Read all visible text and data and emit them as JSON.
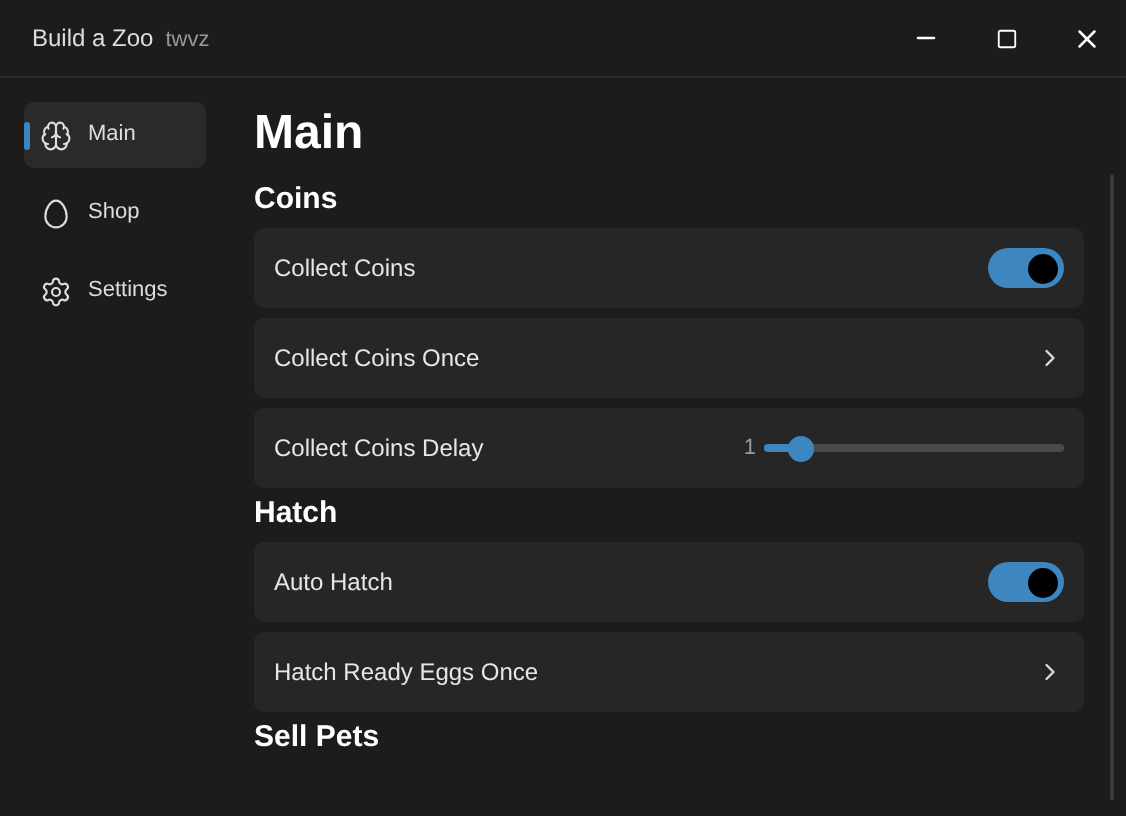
{
  "window": {
    "title": "Build a Zoo",
    "subtitle": "twvz"
  },
  "sidebar": {
    "items": [
      {
        "label": "Main",
        "kind": "brain",
        "selected": true
      },
      {
        "label": "Shop",
        "kind": "egg",
        "selected": false
      },
      {
        "label": "Settings",
        "kind": "gear",
        "selected": false
      }
    ]
  },
  "page": {
    "title": "Main",
    "sections": [
      {
        "title": "Coins",
        "rows": [
          {
            "kind": "toggle",
            "label": "Collect Coins",
            "on": true
          },
          {
            "kind": "button",
            "label": "Collect Coins Once"
          },
          {
            "kind": "slider",
            "label": "Collect Coins Delay",
            "reading": "1",
            "level": 0.12
          }
        ]
      },
      {
        "title": "Hatch",
        "rows": [
          {
            "kind": "toggle",
            "label": "Auto Hatch",
            "on": true
          },
          {
            "kind": "button",
            "label": "Hatch Ready Eggs Once"
          }
        ]
      },
      {
        "title": "Sell Pets"
      }
    ]
  }
}
